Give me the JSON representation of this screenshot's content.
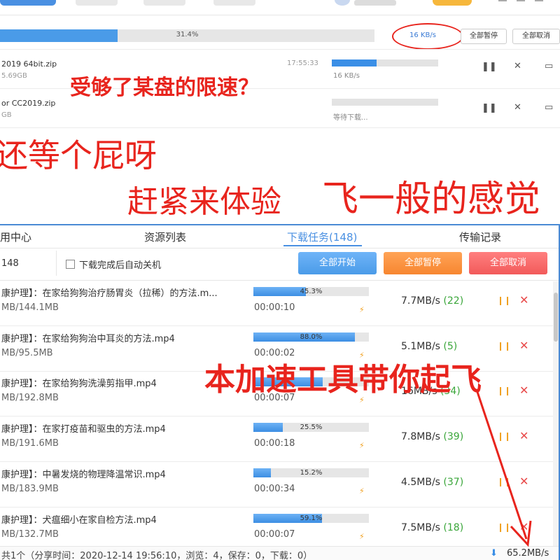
{
  "top_panel": {
    "total_progress": {
      "percent_text": "31.4%",
      "fraction": 0.314
    },
    "speed": "16 KB/s",
    "pause_all": "全部暂停",
    "cancel_all": "全部取消",
    "rows": [
      {
        "name": "2019 64bit.zip",
        "size": "5.69GB",
        "time": "17:55:33",
        "progress": 0.42,
        "status": "16 KB/s"
      },
      {
        "name": "or CC2019.zip",
        "size": "GB",
        "time": "",
        "progress": 0.0,
        "status": "等待下载..."
      }
    ]
  },
  "overlay": {
    "caption1": "受够了某盘的限速？",
    "caption2": "还等个屁呀",
    "caption3": "赶紧来体验",
    "caption4": "飞一般的感觉",
    "caption5": "本加速工具带你起飞"
  },
  "bottom_panel": {
    "tabs": [
      "用中心",
      "资源列表",
      "下载任务(148)",
      "传输记录"
    ],
    "active_tab": 2,
    "count": "148",
    "auto_shutdown_label": "下载完成后自动关机",
    "start_all": "全部开始",
    "pause_all": "全部暂停",
    "cancel_all": "全部取消",
    "rows": [
      {
        "title": "康护理】：在家给狗狗治疗肠胃炎（拉稀）的方法.m...",
        "size": "MB/144.1MB",
        "percent": "45.3%",
        "fraction": 0.453,
        "eta": "00:00:10",
        "speed": "7.7MB/s",
        "conn": "(22)"
      },
      {
        "title": "康护理】：在家给狗狗治中耳炎的方法.mp4",
        "size": "MB/95.5MB",
        "percent": "88.0%",
        "fraction": 0.88,
        "eta": "00:00:02",
        "speed": "5.1MB/s",
        "conn": "(5)"
      },
      {
        "title": "康护理】：在家给狗狗洗澡剪指甲.mp4",
        "size": "MB/192.8MB",
        "percent": "",
        "fraction": 0.6,
        "eta": "00:00:07",
        "speed": "16MB/s",
        "conn": "(34)"
      },
      {
        "title": "康护理】：在家打疫苗和驱虫的方法.mp4",
        "size": "MB/191.6MB",
        "percent": "25.5%",
        "fraction": 0.255,
        "eta": "00:00:18",
        "speed": "7.8MB/s",
        "conn": "(39)"
      },
      {
        "title": "康护理】：中暑发烧的物理降温常识.mp4",
        "size": "MB/183.9MB",
        "percent": "15.2%",
        "fraction": 0.152,
        "eta": "00:00:34",
        "speed": "4.5MB/s",
        "conn": "(37)"
      },
      {
        "title": "康护理】：犬瘟细小在家自检方法.mp4",
        "size": "MB/132.7MB",
        "percent": "59.1%",
        "fraction": 0.591,
        "eta": "00:00:07",
        "speed": "7.5MB/s",
        "conn": "(18)"
      }
    ],
    "status_text": "共1个（分享时间：2020-12-14 19:56:10，浏览：4，保存：0，下载：0）",
    "total_speed": "65.2MB/s"
  },
  "colors": {
    "accent": "#4a90e2",
    "annotation_red": "#e8241d",
    "speed_count_green": "#3aa63a",
    "pause_orange": "#f0a020"
  },
  "icons": [
    "pause-icon",
    "close-icon",
    "folder-icon",
    "lightning-icon",
    "download-arrow-icon",
    "close-x-icon"
  ]
}
